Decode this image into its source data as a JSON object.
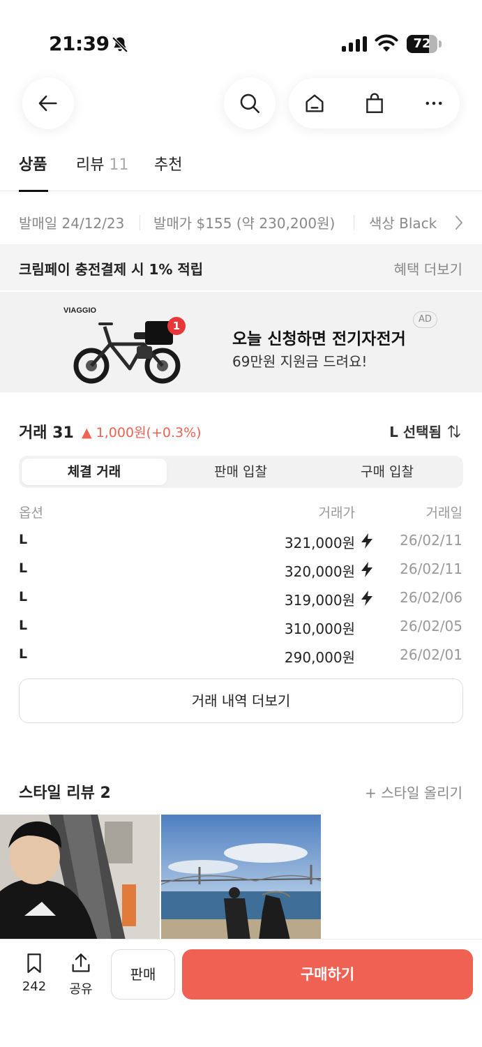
{
  "status_bar": {
    "time": "21:39",
    "battery": "72",
    "battery_level": 0.72,
    "icons": [
      "bell-slash-icon",
      "signal-icon",
      "wifi-icon",
      "battery-icon"
    ]
  },
  "top_nav": {
    "icons": [
      "back-arrow-icon",
      "search-icon",
      "home-icon",
      "shopping-bag-icon",
      "more-icon"
    ]
  },
  "tabs": [
    {
      "label": "상품",
      "count": ""
    },
    {
      "label": "리뷰",
      "count": "11"
    },
    {
      "label": "추천",
      "count": ""
    }
  ],
  "info_row": {
    "release_date": "발매일 24/12/23",
    "release_price": "발매가 $155 (약 230,200원)",
    "color": "색상 Black"
  },
  "benefit": {
    "text": "크림페이 충전결제 시 1% 적립",
    "link": "혜택 더보기"
  },
  "ad": {
    "brand": "VIAGGIO",
    "badge_count": "1",
    "title": "오늘 신청하면 전기자전거",
    "subtitle": "69만원 지원금 드려요!",
    "label": "AD"
  },
  "trades": {
    "title": "거래 31",
    "change": "1,000원(+0.3%)",
    "size_selected": "L 선택됨",
    "segments": [
      "체결 거래",
      "판매 입찰",
      "구매 입찰"
    ],
    "columns": [
      "옵션",
      "거래가",
      "거래일"
    ],
    "rows": [
      {
        "option": "L",
        "price": "321,000원",
        "quick": true,
        "date": "26/02/11"
      },
      {
        "option": "L",
        "price": "320,000원",
        "quick": true,
        "date": "26/02/11"
      },
      {
        "option": "L",
        "price": "319,000원",
        "quick": true,
        "date": "26/02/06"
      },
      {
        "option": "L",
        "price": "310,000원",
        "quick": false,
        "date": "26/02/05"
      },
      {
        "option": "L",
        "price": "290,000원",
        "quick": false,
        "date": "26/02/01"
      }
    ],
    "more_label": "거래 내역 더보기"
  },
  "style_review": {
    "title": "스타일 리뷰 2",
    "upload_label": "+ 스타일 올리기"
  },
  "bottom_bar": {
    "bookmark_count": "242",
    "share_label": "공유",
    "sell_label": "판매",
    "buy_label": "구매하기"
  },
  "colors": {
    "accent": "#ef6253",
    "text": "#222222",
    "muted": "#888888"
  }
}
